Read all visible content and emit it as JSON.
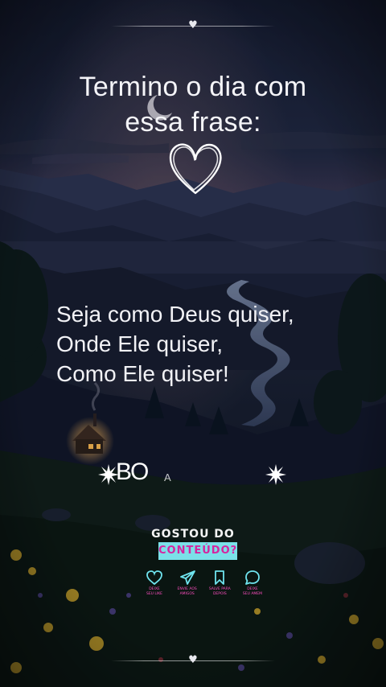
{
  "title_lines": [
    "Termino o dia com",
    "essa frase:"
  ],
  "quote_lines": [
    "Seja como Deus quiser,",
    "Onde Ele quiser,",
    "Como Ele quiser!"
  ],
  "typing": {
    "big": "BO",
    "small": "A"
  },
  "divider_heart": "♥",
  "cta": {
    "heading": "GOSTOU DO",
    "badge": "CONTEÚDO?",
    "actions": [
      {
        "icon": "heart-outline-icon",
        "label_1": "DEIXE",
        "label_2": "SEU LIKE"
      },
      {
        "icon": "send-icon",
        "label_1": "ENVIE AOS",
        "label_2": "AMIGOS"
      },
      {
        "icon": "bookmark-icon",
        "label_1": "SALVE PARA",
        "label_2": "DEPOIS"
      },
      {
        "icon": "comment-icon",
        "label_1": "DEIXE",
        "label_2": "SEU AMEM"
      }
    ]
  },
  "colors": {
    "text": "#f2f2f6",
    "badge_bg": "#7be0e8",
    "badge_text": "#d6249f",
    "action_icon": "#6fe3ee",
    "action_label": "#ff4fc1"
  }
}
